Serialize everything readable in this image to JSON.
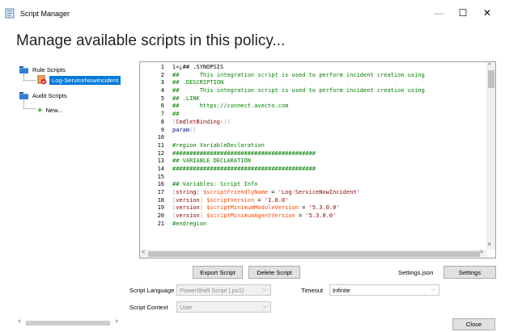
{
  "window": {
    "title": "Script Manager",
    "minimize": "—",
    "maximize": "☐",
    "close": "✕"
  },
  "heading": "Manage available scripts in this policy...",
  "tree": {
    "rule_scripts": "Rule Scripts",
    "rule_child": "Log-ServiceNowIncident",
    "audit_scripts": "Audit Scripts",
    "audit_child": "New..."
  },
  "code": [
    {
      "n": "1",
      "t": "ï»¿## .SYNOPSIS"
    },
    {
      "n": "2",
      "t": "##      This integration script is used to perform incident creation using"
    },
    {
      "n": "3",
      "t": "## .DESCRIPTION"
    },
    {
      "n": "4",
      "t": "##      This integration script is used to perform incident creation using"
    },
    {
      "n": "5",
      "t": "## .LINK"
    },
    {
      "n": "6",
      "t": "##      https://connect.avecto.com"
    },
    {
      "n": "7",
      "t": "##"
    },
    {
      "n": "8",
      "t": "[CmdletBinding()]"
    },
    {
      "n": "9",
      "t": "param()"
    },
    {
      "n": "10",
      "t": ""
    },
    {
      "n": "11",
      "t": "#region VariableDeclaration"
    },
    {
      "n": "12",
      "t": "##########################################"
    },
    {
      "n": "13",
      "t": "## VARIABLE DECLARATION"
    },
    {
      "n": "14",
      "t": "##########################################"
    },
    {
      "n": "15",
      "t": ""
    },
    {
      "n": "16",
      "t": "## Variables: Script Info"
    },
    {
      "n": "17",
      "t": "[string] $scriptFriendlyName = 'Log-ServiceNowIncident'"
    },
    {
      "n": "18",
      "t": "[version] $scriptVersion = '1.0.0'"
    },
    {
      "n": "19",
      "t": "[version] $scriptMinimumModuleVersion = '5.3.0.0'"
    },
    {
      "n": "20",
      "t": "[version] $scriptMinimumAgentVersion = '5.3.0.0'"
    },
    {
      "n": "21",
      "t": "#endregion"
    }
  ],
  "buttons": {
    "export": "Export Script",
    "delete": "Delete Script",
    "settings_file": "Settings.json",
    "settings": "Settings",
    "close": "Close"
  },
  "fields": {
    "language_label": "Script Language",
    "language_value": "PowerShell Script (.ps1)",
    "context_label": "Script Context",
    "context_value": "User",
    "timeout_label": "Timeout",
    "timeout_value": "Infinite"
  },
  "colors": {
    "selection": "#0078d7",
    "folder": "#2f7fd0",
    "comment": "#008000",
    "variable": "#ff4500",
    "string": "#8b0000"
  },
  "icons": [
    "app-icon",
    "folder-icon",
    "script-icon",
    "add-icon",
    "chevron-down-icon"
  ]
}
